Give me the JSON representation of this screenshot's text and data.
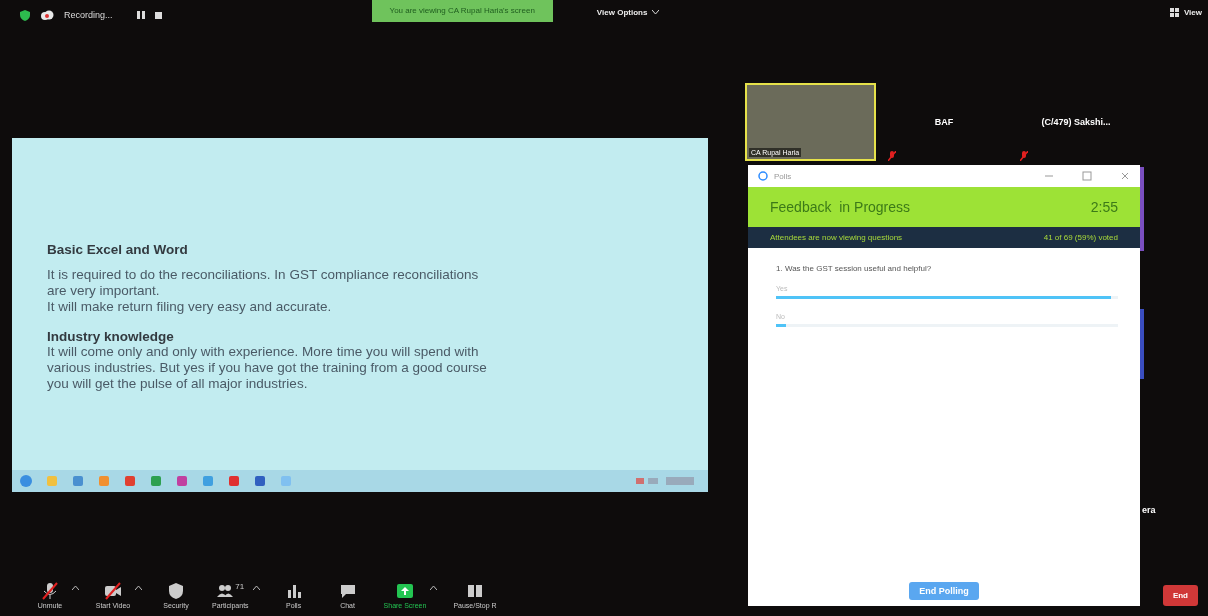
{
  "top_bar": {
    "recording_label": "Recording...",
    "banner": "You are viewing CA Rupal Haria's screen",
    "view_options": "View Options",
    "view": "View"
  },
  "shared_screen": {
    "sections": [
      {
        "heading": "Basic Excel and Word",
        "paragraphs": [
          "It is required to do the reconciliations. In GST compliance reconciliations are very important.",
          "It will make return filing very easy and accurate."
        ]
      },
      {
        "heading": "Industry knowledge",
        "paragraphs": [
          "It will come only and only with experience. More time you will spend with various industries. But yes if you have got the training from a good course you will get the pulse of all major industries."
        ]
      }
    ]
  },
  "participants": [
    {
      "name": "CA Rupal Haria",
      "kind": "video",
      "muted": false,
      "active_speaker": true
    },
    {
      "name": "BAF",
      "kind": "name",
      "muted": true,
      "active_speaker": false
    },
    {
      "name": "(C/479) Sakshi...",
      "kind": "name",
      "muted": true,
      "active_speaker": false
    }
  ],
  "side_tile": {
    "name": "era"
  },
  "polls_window": {
    "title": "Polls",
    "poll_title": "Feedback  in Progress",
    "timer": "2:55",
    "status": "Attendees are now viewing questions",
    "votes": "41 of 69 (59%) voted",
    "question": "1. Was the GST session useful and helpful?",
    "options": [
      {
        "label": "Yes",
        "level": 0.98
      },
      {
        "label": "No",
        "level": 0.03
      }
    ],
    "end_button": "End Polling"
  },
  "toolbar": {
    "buttons": [
      {
        "kind": "mic",
        "label": "Unmute",
        "caret": true,
        "off": true
      },
      {
        "kind": "video",
        "label": "Start Video",
        "caret": true,
        "off": true
      },
      {
        "kind": "security",
        "label": "Security",
        "caret": false,
        "off": false
      },
      {
        "kind": "participants",
        "label": "Participants",
        "caret": true,
        "off": false,
        "count": "71"
      },
      {
        "kind": "polls",
        "label": "Polls",
        "caret": false,
        "off": false
      },
      {
        "kind": "chat",
        "label": "Chat",
        "caret": false,
        "off": false
      },
      {
        "kind": "share",
        "label": "Share Screen",
        "caret": true,
        "off": false
      },
      {
        "kind": "record",
        "label": "Pause/Stop R",
        "caret": false,
        "off": false
      }
    ],
    "end": "End"
  }
}
